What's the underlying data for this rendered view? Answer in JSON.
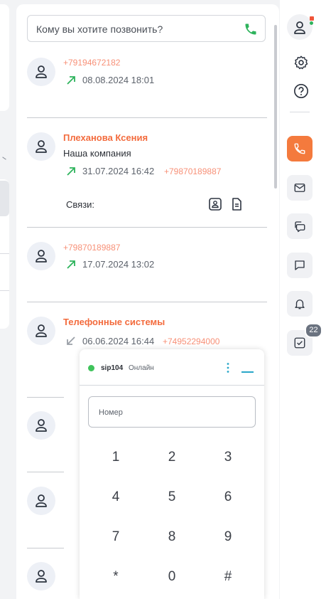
{
  "search": {
    "placeholder": "Кому вы хотите позвонить?"
  },
  "calls": [
    {
      "number": "+79194672182",
      "direction": "outgoing",
      "datetime": "08.08.2024 18:01"
    },
    {
      "name": "Плеханова Ксения",
      "company": "Наша компания",
      "direction": "outgoing",
      "datetime": "31.07.2024 16:42",
      "number": "+79870189887",
      "links_label": "Связи:"
    },
    {
      "number": "+79870189887",
      "direction": "outgoing",
      "datetime": "17.07.2024 13:02"
    },
    {
      "name": "Телефонные системы",
      "direction": "incoming",
      "datetime": "06.06.2024 16:44",
      "number": "+74952294000"
    }
  ],
  "dialer": {
    "account": "sip104",
    "status": "Онлайн",
    "input_placeholder": "Номер",
    "keys": [
      "1",
      "2",
      "3",
      "4",
      "5",
      "6",
      "7",
      "8",
      "9",
      "*",
      "0",
      "#"
    ]
  },
  "rail": {
    "tasks_badge": "22",
    "icons": [
      "user-icon",
      "gear-icon",
      "help-icon",
      "phone-icon",
      "mail-icon",
      "chats-icon",
      "message-icon",
      "bell-icon",
      "tasks-icon"
    ]
  },
  "colors": {
    "accent": "#f47a3d",
    "green": "#2eb35c",
    "online": "#3fc35b",
    "name": "#f36b3d"
  }
}
